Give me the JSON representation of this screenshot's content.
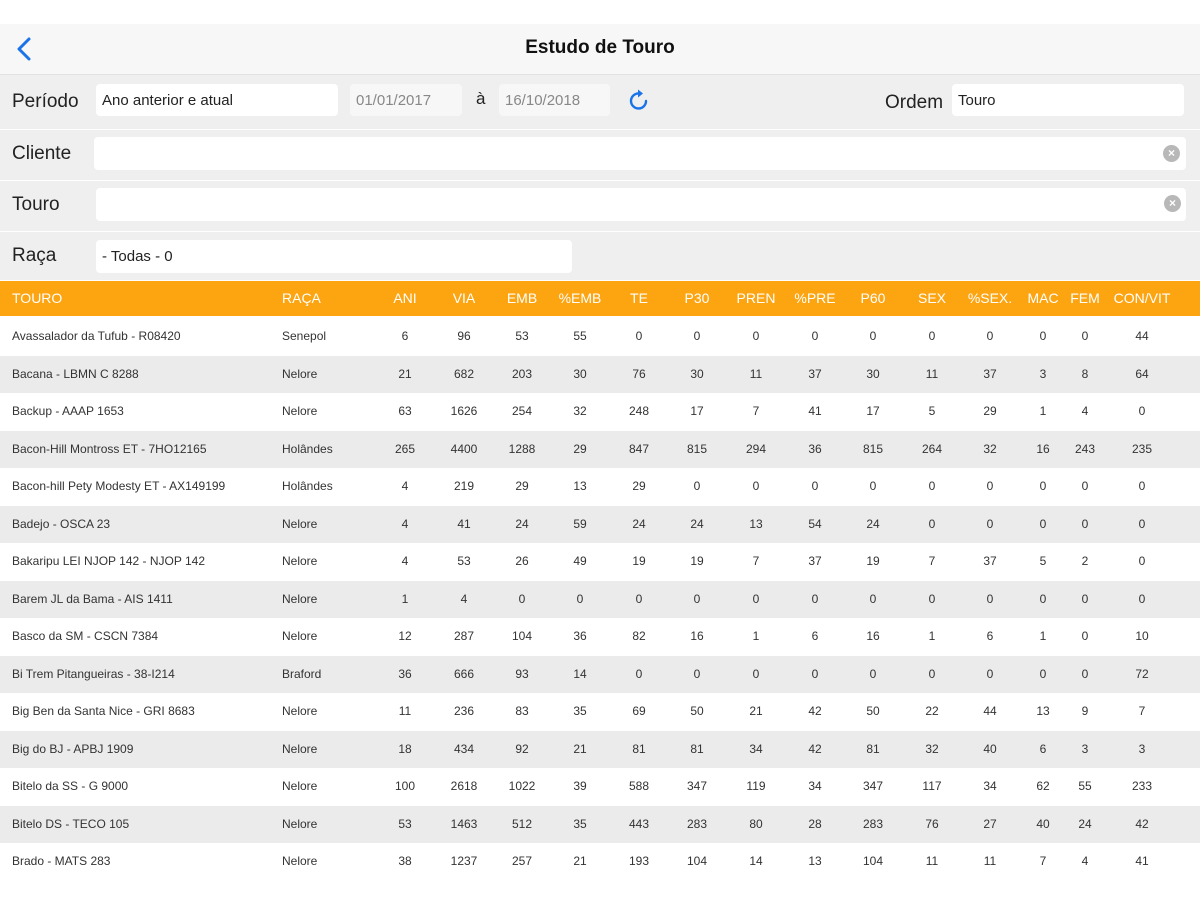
{
  "header": {
    "title": "Estudo de Touro"
  },
  "filters": {
    "periodo_label": "Período",
    "periodo_value": "Ano anterior e atual",
    "date_from": "01/01/2017",
    "date_sep": "à",
    "date_to": "16/10/2018",
    "ordem_label": "Ordem",
    "ordem_value": "Touro",
    "cliente_label": "Cliente",
    "cliente_value": "",
    "touro_label": "Touro",
    "touro_value": "",
    "raca_label": "Raça",
    "raca_value": "- Todas - 0"
  },
  "icons": {
    "back": "chevron-left-icon",
    "refresh": "refresh-icon",
    "clear": "clear-circle-icon"
  },
  "colors": {
    "accent": "#fda411",
    "link": "#1a73e8"
  },
  "table": {
    "columns": [
      "TOURO",
      "RAÇA",
      "ANI",
      "VIA",
      "EMB",
      "%EMB",
      "TE",
      "P30",
      "PREN",
      "%PRE",
      "P60",
      "SEX",
      "%SEX.",
      "MAC",
      "FEM",
      "CON/VIT"
    ],
    "rows": [
      [
        "Avassalador da Tufub - R08420",
        "Senepol",
        "6",
        "96",
        "53",
        "55",
        "0",
        "0",
        "0",
        "0",
        "0",
        "0",
        "0",
        "0",
        "0",
        "44"
      ],
      [
        "Bacana - LBMN C 8288",
        "Nelore",
        "21",
        "682",
        "203",
        "30",
        "76",
        "30",
        "11",
        "37",
        "30",
        "11",
        "37",
        "3",
        "8",
        "64"
      ],
      [
        "Backup - AAAP 1653",
        "Nelore",
        "63",
        "1626",
        "254",
        "32",
        "248",
        "17",
        "7",
        "41",
        "17",
        "5",
        "29",
        "1",
        "4",
        "0"
      ],
      [
        "Bacon-Hill Montross ET - 7HO12165",
        "Holândes",
        "265",
        "4400",
        "1288",
        "29",
        "847",
        "815",
        "294",
        "36",
        "815",
        "264",
        "32",
        "16",
        "243",
        "235"
      ],
      [
        "Bacon-hill Pety Modesty ET - AX149199",
        "Holândes",
        "4",
        "219",
        "29",
        "13",
        "29",
        "0",
        "0",
        "0",
        "0",
        "0",
        "0",
        "0",
        "0",
        "0"
      ],
      [
        "Badejo - OSCA 23",
        "Nelore",
        "4",
        "41",
        "24",
        "59",
        "24",
        "24",
        "13",
        "54",
        "24",
        "0",
        "0",
        "0",
        "0",
        "0"
      ],
      [
        "Bakaripu LEI NJOP 142 - NJOP 142",
        "Nelore",
        "4",
        "53",
        "26",
        "49",
        "19",
        "19",
        "7",
        "37",
        "19",
        "7",
        "37",
        "5",
        "2",
        "0"
      ],
      [
        "Barem JL da Bama - AIS 1411",
        "Nelore",
        "1",
        "4",
        "0",
        "0",
        "0",
        "0",
        "0",
        "0",
        "0",
        "0",
        "0",
        "0",
        "0",
        "0"
      ],
      [
        "Basco da SM - CSCN 7384",
        "Nelore",
        "12",
        "287",
        "104",
        "36",
        "82",
        "16",
        "1",
        "6",
        "16",
        "1",
        "6",
        "1",
        "0",
        "10"
      ],
      [
        "Bi Trem Pitangueiras - 38-I214",
        "Braford",
        "36",
        "666",
        "93",
        "14",
        "0",
        "0",
        "0",
        "0",
        "0",
        "0",
        "0",
        "0",
        "0",
        "72"
      ],
      [
        "Big Ben da Santa Nice - GRI 8683",
        "Nelore",
        "11",
        "236",
        "83",
        "35",
        "69",
        "50",
        "21",
        "42",
        "50",
        "22",
        "44",
        "13",
        "9",
        "7"
      ],
      [
        "Big do BJ - APBJ 1909",
        "Nelore",
        "18",
        "434",
        "92",
        "21",
        "81",
        "81",
        "34",
        "42",
        "81",
        "32",
        "40",
        "6",
        "3",
        "3"
      ],
      [
        "Bitelo da SS - G 9000",
        "Nelore",
        "100",
        "2618",
        "1022",
        "39",
        "588",
        "347",
        "119",
        "34",
        "347",
        "117",
        "34",
        "62",
        "55",
        "233"
      ],
      [
        "Bitelo DS - TECO 105",
        "Nelore",
        "53",
        "1463",
        "512",
        "35",
        "443",
        "283",
        "80",
        "28",
        "283",
        "76",
        "27",
        "40",
        "24",
        "42"
      ],
      [
        "Brado - MATS 283",
        "Nelore",
        "38",
        "1237",
        "257",
        "21",
        "193",
        "104",
        "14",
        "13",
        "104",
        "11",
        "11",
        "7",
        "4",
        "41"
      ]
    ]
  }
}
